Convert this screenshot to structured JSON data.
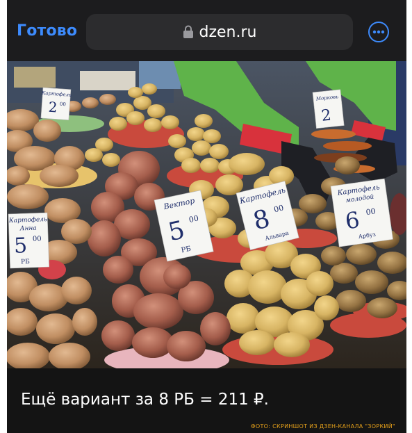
{
  "browser": {
    "done_label": "Готово",
    "url": "dzen.ru",
    "accent_color": "#3d8bfd"
  },
  "photo": {
    "signs": [
      {
        "line1": "Картофель",
        "line2": "Анна",
        "price": "5",
        "kopecks": "00",
        "unit": "РБ"
      },
      {
        "line1": "Вектор",
        "line2": "",
        "price": "5",
        "kopecks": "00",
        "unit": "РБ"
      },
      {
        "line1": "Картофель",
        "line2": "",
        "price": "8",
        "kopecks": "00",
        "unit": "Альвара"
      },
      {
        "line1": "Картофель",
        "line2": "молодой",
        "price": "6",
        "kopecks": "00",
        "unit": "Арбуз"
      },
      {
        "line1": "Картофель",
        "line2": "",
        "price": "2",
        "kopecks": "00",
        "unit": ""
      },
      {
        "line1": "Морковь",
        "line2": "",
        "price": "2",
        "kopecks": "",
        "unit": ""
      }
    ]
  },
  "caption": {
    "text": "Ещё вариант за 8 РБ = 211 ₽.",
    "credit": "ФОТО: СКРИНШОТ ИЗ ДЗЕН-КАНАЛА \"ЗОРКИЙ\"",
    "credit_color": "#e8a21a"
  },
  "icons": {
    "lock": "lock-icon",
    "more": "more-options-icon"
  }
}
